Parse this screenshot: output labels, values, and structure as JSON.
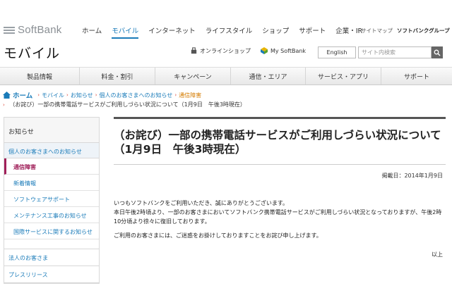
{
  "brand": {
    "logo_text": "SoftBank"
  },
  "global_nav": [
    {
      "label": "ホーム",
      "active": false
    },
    {
      "label": "モバイル",
      "active": true
    },
    {
      "label": "インターネット",
      "active": false
    },
    {
      "label": "ライフスタイル",
      "active": false
    },
    {
      "label": "ショップ",
      "active": false
    },
    {
      "label": "サポート",
      "active": false
    },
    {
      "label": "企業・IR",
      "active": false
    }
  ],
  "util_links": {
    "arrow": "›",
    "sitemap": "サイトマップ",
    "group": "ソフトバンクグループ"
  },
  "section": {
    "title": "モバイル"
  },
  "header_tools": {
    "online_shop": "オンラインショップ",
    "my_softbank": "My SoftBank",
    "english": "English",
    "search_placeholder": "サイト内検索"
  },
  "category_nav": [
    "製品情報",
    "料金・割引",
    "キャンペーン",
    "通信・エリア",
    "サービス・アプリ",
    "サポート"
  ],
  "breadcrumb": {
    "home": "ホーム",
    "sep": "›",
    "items": [
      "モバイル",
      "お知らせ",
      "個人のお客さまへのお知らせ"
    ],
    "current": "通信障害",
    "page": "（お詫び）一部の携帯電話サービスがご利用しづらい状況について（1月9日　午後3時現在）"
  },
  "sidebar": {
    "heading": "お知らせ",
    "parent": "個人のお客さまへのお知らせ",
    "items": [
      {
        "label": "通信障害",
        "current": true
      },
      {
        "label": "新着情報",
        "current": false
      },
      {
        "label": "ソフトウェアサポート",
        "current": false
      },
      {
        "label": "メンテナンス工事のお知らせ",
        "current": false
      },
      {
        "label": "国際サービスに関するお知らせ",
        "current": false
      }
    ],
    "others": [
      "法人のお客さま",
      "プレスリリース"
    ]
  },
  "article": {
    "title_line1": "（お詫び）一部の携帯電話サービスがご利用しづらい状況について",
    "title_line2": "（1月9日　午後3時現在）",
    "posted": "掲載日：2014年1月9日",
    "p1_line1": "いつもソフトバンクをご利用いただき、誠にありがとうございます。",
    "p1_line2": "本日午後2時頃より、一部のお客さまにおいてソフトバンク携帯電話サービスがご利用しづらい状況となっておりますが、午後2時10分頃より徐々に復旧しております。",
    "p2": "ご利用のお客さまには、ご迷惑をお掛けしておりますことをお詫び申し上げます。",
    "closing": "以上"
  },
  "colors": {
    "link": "#1a7bb9",
    "current_side": "#a0205a",
    "current_crumb": "#d47b00"
  },
  "icons": [
    "softbank-logo-icon",
    "cart-icon",
    "mysoftbank-icon",
    "search-icon",
    "home-icon"
  ]
}
